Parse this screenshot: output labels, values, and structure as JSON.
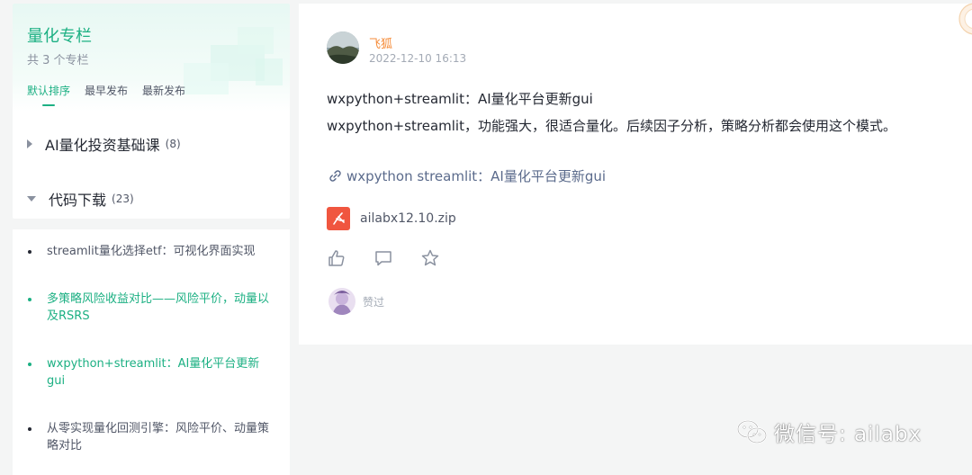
{
  "column": {
    "title": "量化专栏",
    "count": "共 3 个专栏",
    "sort_tabs": [
      "默认排序",
      "最早发布",
      "最新发布"
    ],
    "active_sort": 0
  },
  "categories": [
    {
      "name": "AI量化投资基础课",
      "count": "(8)",
      "expanded": false
    },
    {
      "name": "代码下载",
      "count": "(23)",
      "expanded": true
    }
  ],
  "articles": [
    {
      "title": "streamlit量化选择etf：可视化界面实现",
      "highlighted": false
    },
    {
      "title": "多策略风险收益对比——风险平价，动量以及RSRS",
      "highlighted": true
    },
    {
      "title": "wxpython+streamlit：AI量化平台更新gui",
      "highlighted": true
    },
    {
      "title": "从零实现量化回测引擎：风险平价、动量策略对比",
      "highlighted": false
    }
  ],
  "post": {
    "author": "飞狐",
    "date": "2022-12-10 16:13",
    "title": "wxpython+streamlit：AI量化平台更新gui",
    "body": "wxpython+streamlit，功能强大，很适合量化。后续因子分析，策略分析都会使用这个模式。",
    "link_text": "wxpython streamlit：AI量化平台更新gui",
    "attachment": "ailabx12.10.zip",
    "liked_label": "赞过"
  },
  "icons": {
    "link": "link-icon",
    "file": "pdf-file-icon",
    "like": "thumbs-up-icon",
    "comment": "comment-icon",
    "star": "star-icon",
    "wechat": "wechat-icon"
  },
  "colors": {
    "accent": "#1cb083",
    "author": "#f58b38",
    "link": "#5b6b8c",
    "file": "#f0563f"
  },
  "watermark": "微信号: ailabx"
}
